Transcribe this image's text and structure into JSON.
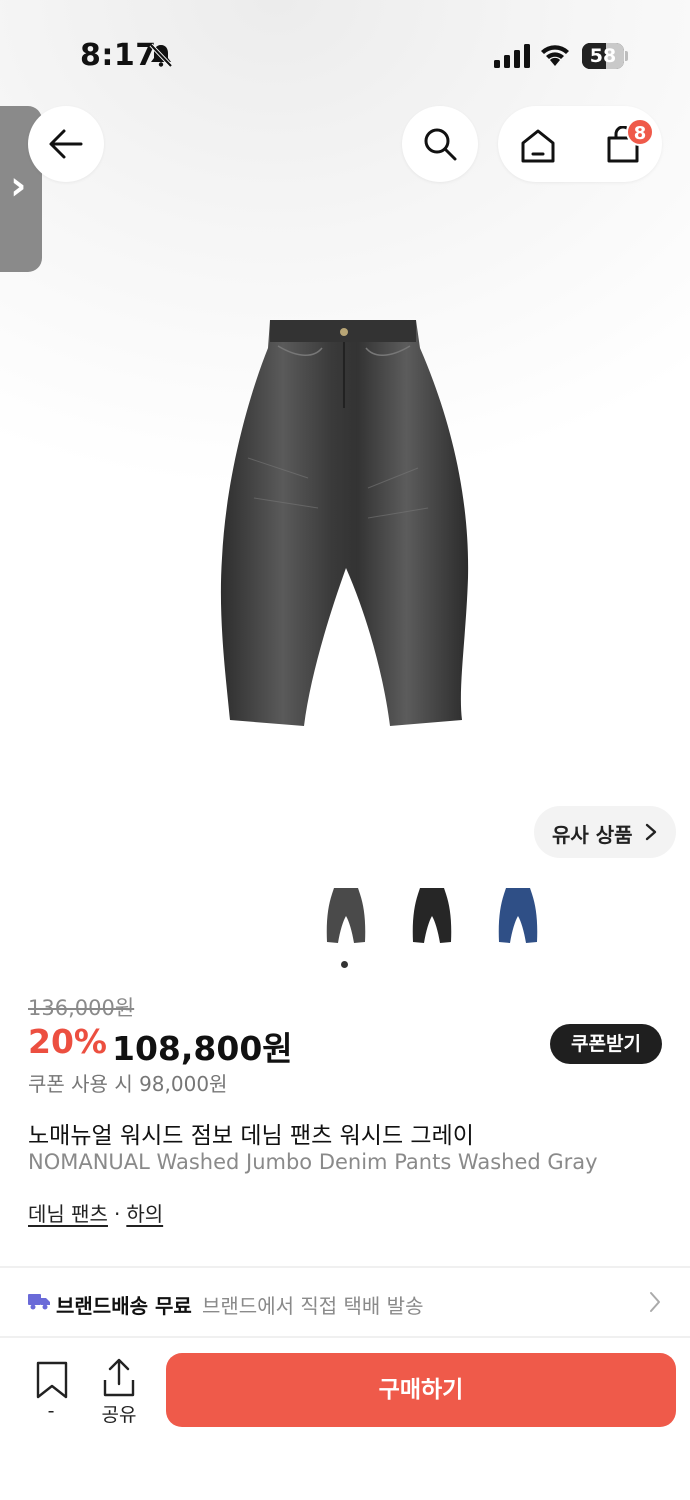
{
  "status_bar": {
    "time": "8:17",
    "battery": "58",
    "battery_level": 0.58
  },
  "header": {
    "cart_count": "8"
  },
  "product_images": {
    "similar_label": "유사 상품",
    "variant_count": 3,
    "active_index": 0
  },
  "price": {
    "original": "136,000원",
    "discount": "20%",
    "current": "108,800원",
    "coupon_button": "쿠폰받기",
    "coupon_price": "쿠폰 사용 시 98,000원"
  },
  "product": {
    "title_ko": "노매뉴얼 워시드 점보 데님 팬츠 워시드 그레이",
    "title_en": "NOMANUAL Washed Jumbo Denim Pants Washed Gray",
    "category_1": "데님 팬츠",
    "separator": "·",
    "category_2": "하의"
  },
  "shipping": {
    "label": "브랜드배송 무료",
    "detail": "브랜드에서 직접 택배 발송"
  },
  "bottom_bar": {
    "bookmark_count": "-",
    "share_label": "공유",
    "buy_label": "구매하기"
  },
  "colors": {
    "accent": "#ef5a4a",
    "discount": "#ec4f40",
    "dark_button": "#1f1f1f",
    "shipping_icon": "#6a6ad8"
  },
  "variants": [
    {
      "name": "washed-gray",
      "color": "#4a4a4a"
    },
    {
      "name": "washed-black",
      "color": "#262626"
    },
    {
      "name": "washed-blue",
      "color": "#2f4f86"
    }
  ]
}
